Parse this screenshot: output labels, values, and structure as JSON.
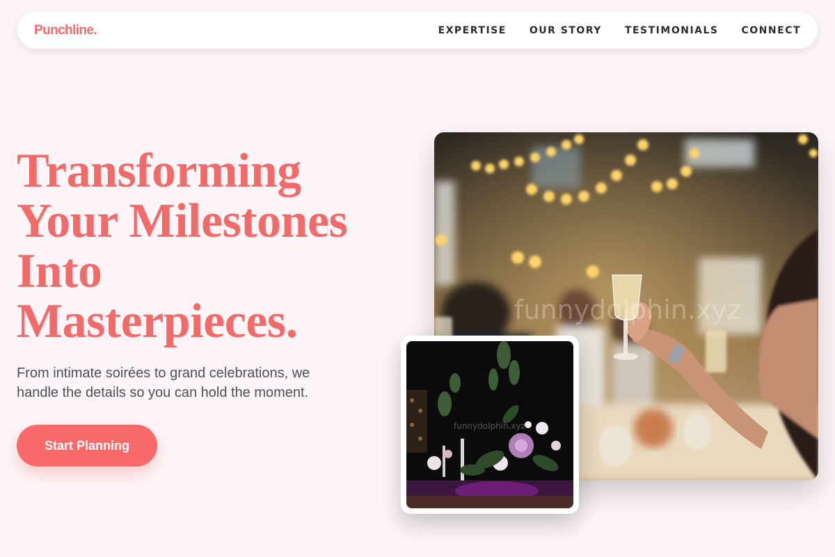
{
  "nav": {
    "brand": "Punchline.",
    "links": [
      "EXPERTISE",
      "OUR STORY",
      "TESTIMONIALS",
      "CONNECT"
    ]
  },
  "hero": {
    "headline_lines": [
      "Transforming",
      "Your Milestones",
      "Into",
      "Masterpieces."
    ],
    "subtext": "From intimate soirées to grand celebrations, we handle the details so you can hold the moment.",
    "cta_label": "Start Planning"
  },
  "images": {
    "main_watermark": "funnydolphin.xyz",
    "small_watermark": "funnydolphin.xyz"
  },
  "colors": {
    "accent": "#f26b6b",
    "button": "#fa6a6a",
    "background": "#fdf5f7",
    "nav_text": "#2b2b2b",
    "body_text": "#4a4f5c"
  }
}
